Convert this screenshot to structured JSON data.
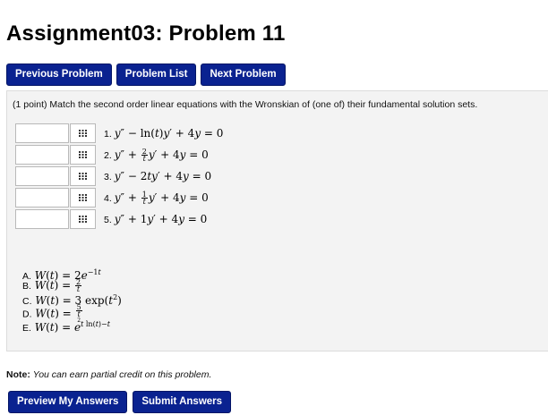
{
  "title": "Assignment03: Problem 11",
  "nav": {
    "previous": "Previous Problem",
    "list": "Problem List",
    "next": "Next Problem"
  },
  "problem": {
    "intro": "(1 point) Match the second order linear equations with the Wronskian of (one of) their fundamental solution sets.",
    "equations": [
      {
        "num": "1.",
        "value": ""
      },
      {
        "num": "2.",
        "value": ""
      },
      {
        "num": "3.",
        "value": ""
      },
      {
        "num": "4.",
        "value": ""
      },
      {
        "num": "5.",
        "value": ""
      }
    ],
    "options": [
      {
        "letter": "A."
      },
      {
        "letter": "B."
      },
      {
        "letter": "C."
      },
      {
        "letter": "D."
      },
      {
        "letter": "E."
      }
    ]
  },
  "note": {
    "label": "Note:",
    "text": "You can earn partial credit on this problem."
  },
  "footer": {
    "preview": "Preview My Answers",
    "submit": "Submit Answers"
  },
  "colors": {
    "button": "#0a2290",
    "panel": "#f3f3f3"
  },
  "icons": {
    "picker": "grid-icon"
  }
}
